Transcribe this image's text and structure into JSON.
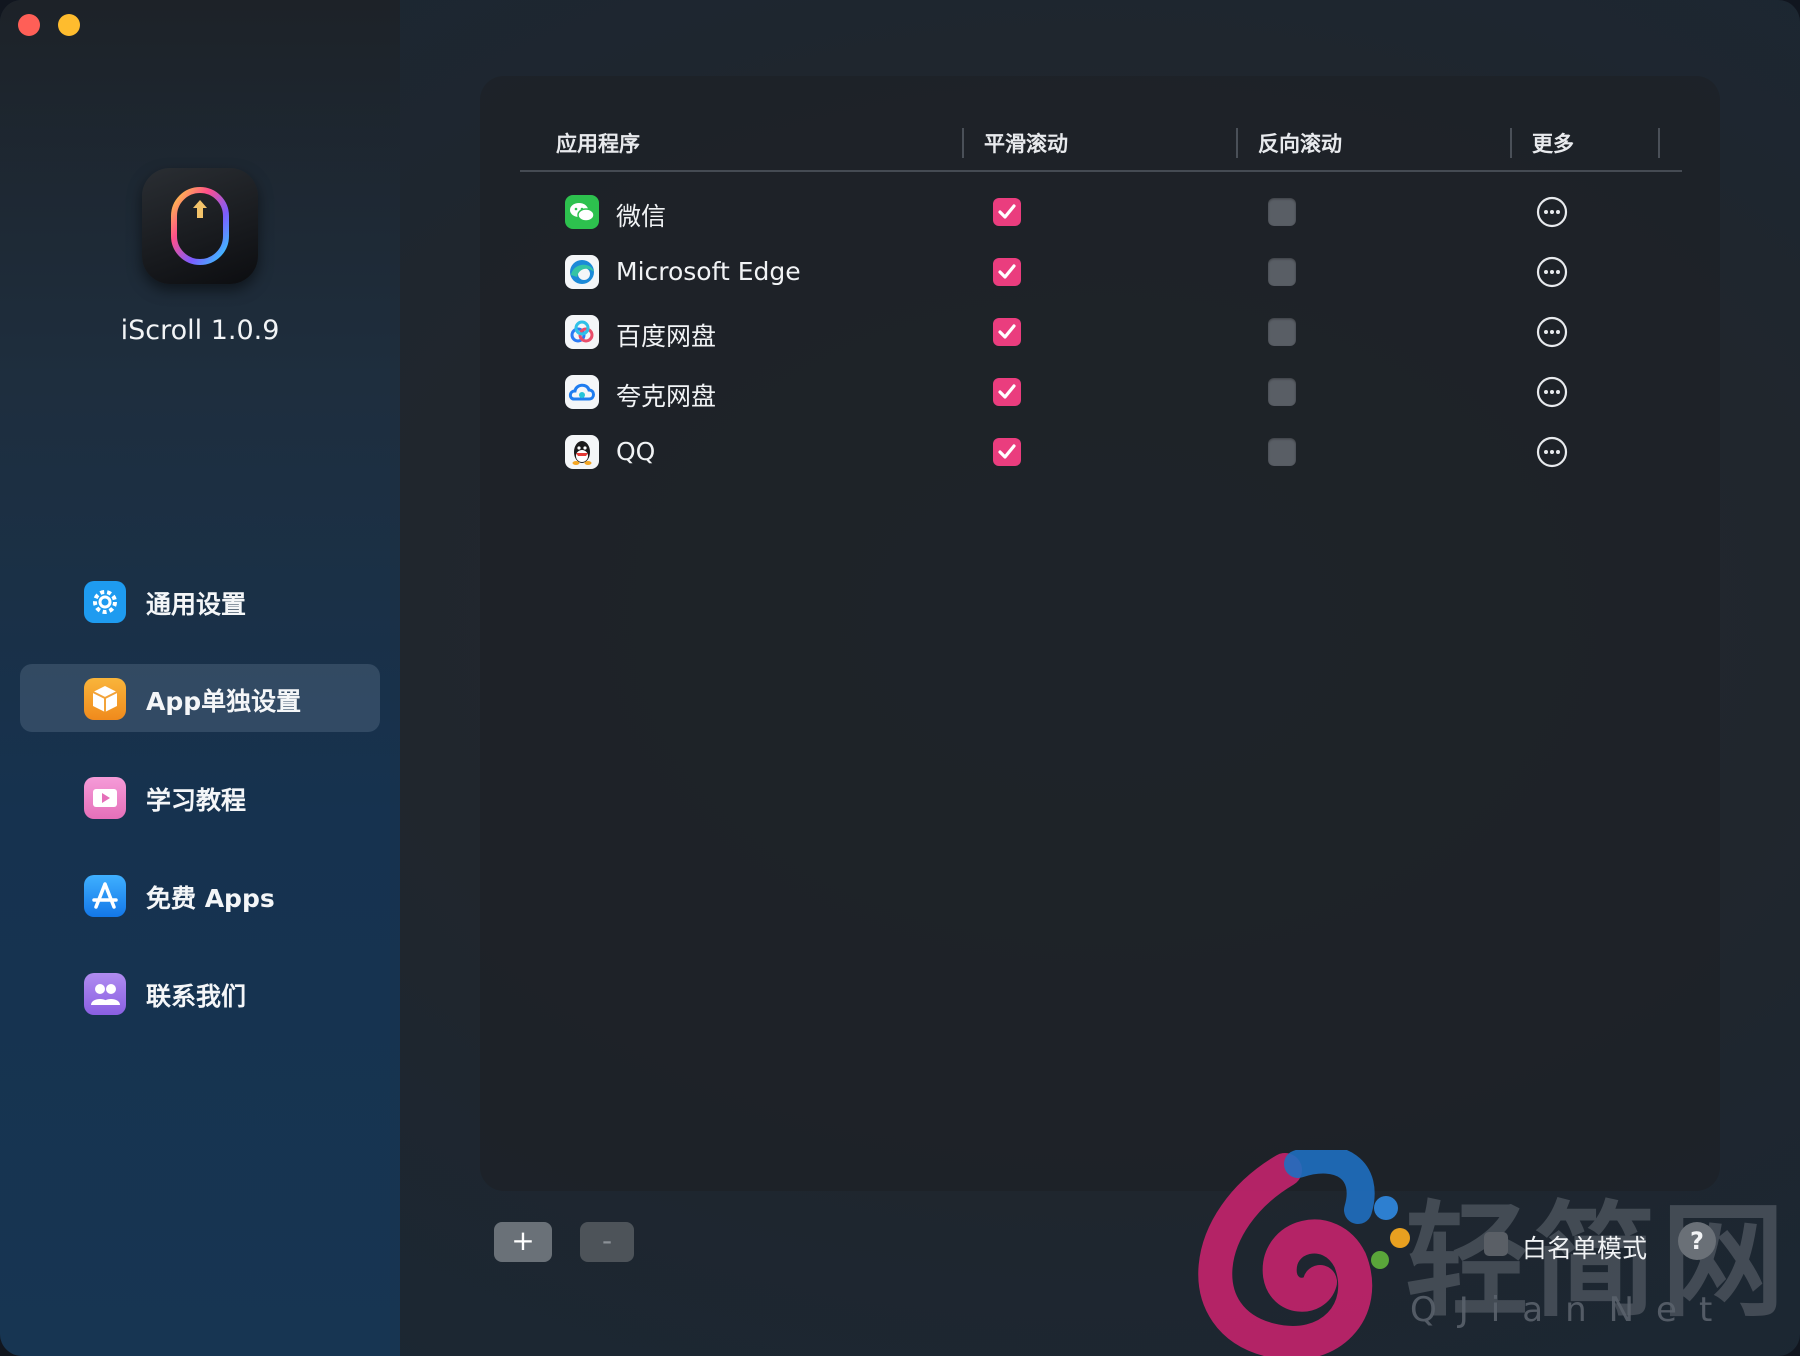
{
  "window": {
    "traffic_lights": [
      "close",
      "minimize"
    ]
  },
  "sidebar": {
    "app_name": "iScroll 1.0.9",
    "items": [
      {
        "label": "通用设置",
        "icon": "gear-icon",
        "color": "#1e9bf0"
      },
      {
        "label": "App单独设置",
        "icon": "box-icon",
        "color": "#f6a321",
        "selected": true
      },
      {
        "label": "学习教程",
        "icon": "video-icon",
        "color": "#ee7cc8"
      },
      {
        "label": "免费 Apps",
        "icon": "app-store-icon",
        "color": "#1f8ef5"
      },
      {
        "label": "联系我们",
        "icon": "people-icon",
        "color": "#9a6ce6"
      }
    ]
  },
  "table": {
    "columns": [
      "应用程序",
      "平滑滚动",
      "反向滚动",
      "更多"
    ],
    "rows": [
      {
        "name": "微信",
        "icon": "wechat-icon",
        "smooth": true,
        "reverse": false
      },
      {
        "name": "Microsoft Edge",
        "icon": "edge-icon",
        "smooth": true,
        "reverse": false
      },
      {
        "name": "百度网盘",
        "icon": "baidu-netdisk-icon",
        "smooth": true,
        "reverse": false
      },
      {
        "name": "夸克网盘",
        "icon": "quark-netdisk-icon",
        "smooth": true,
        "reverse": false
      },
      {
        "name": "QQ",
        "icon": "qq-icon",
        "smooth": true,
        "reverse": false
      }
    ]
  },
  "footer": {
    "add_label": "+",
    "remove_label": "-",
    "whitelist_label": "白名单模式",
    "whitelist_checked": false,
    "help_label": "?"
  },
  "watermark": {
    "title": "轻简网",
    "subtitle": "QJianNet"
  },
  "colors": {
    "accent_checkbox": "#ea3d7e"
  }
}
